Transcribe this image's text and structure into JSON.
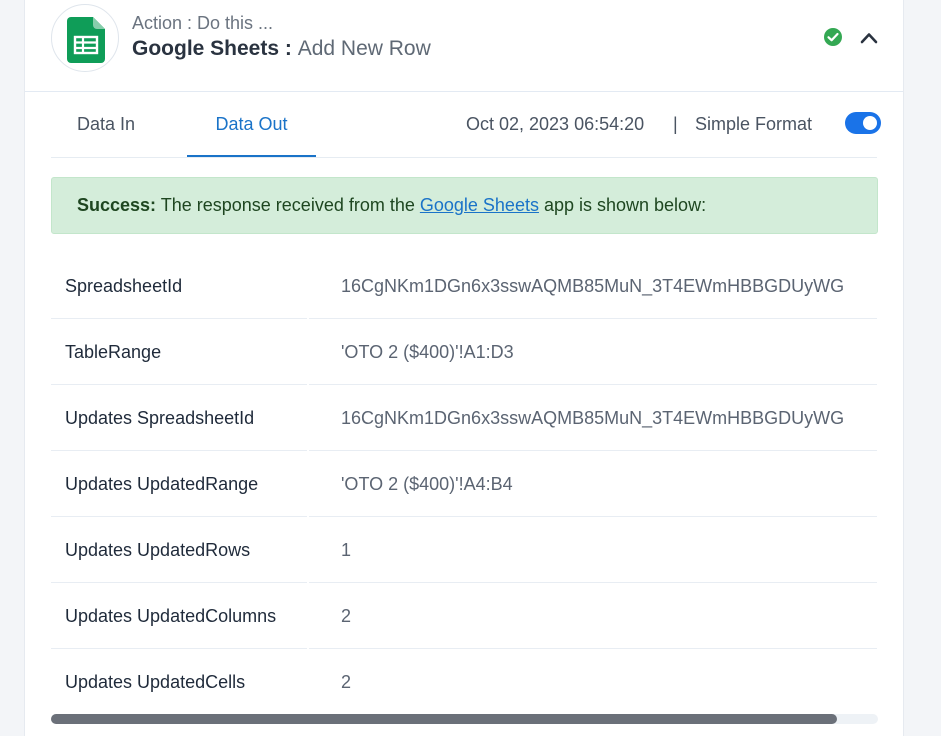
{
  "header": {
    "action_label": "Action : Do this ...",
    "app_name": "Google Sheets :",
    "action_name": "Add New Row",
    "app_icon": "google-sheets-icon",
    "status_icon": "check-circle-icon",
    "collapse_icon": "chevron-up-icon"
  },
  "tabs": [
    {
      "label": "Data In",
      "active": false
    },
    {
      "label": "Data Out",
      "active": true
    }
  ],
  "meta": {
    "timestamp": "Oct 02, 2023 06:54:20",
    "separator": "|",
    "simple_format_label": "Simple Format",
    "simple_format_on": true
  },
  "alert": {
    "prefix": "Success:",
    "text_before": " The response received from the ",
    "link": "Google Sheets",
    "text_after": " app is shown below:"
  },
  "rows": [
    {
      "key": "SpreadsheetId",
      "value": "16CgNKm1DGn6x3sswAQMB85MuN_3T4EWmHBBGDUyWG"
    },
    {
      "key": "TableRange",
      "value": "'OTO 2 ($400)'!A1:D3"
    },
    {
      "key": "Updates SpreadsheetId",
      "value": "16CgNKm1DGn6x3sswAQMB85MuN_3T4EWmHBBGDUyWG"
    },
    {
      "key": "Updates UpdatedRange",
      "value": "'OTO 2 ($400)'!A4:B4"
    },
    {
      "key": "Updates UpdatedRows",
      "value": "1"
    },
    {
      "key": "Updates UpdatedColumns",
      "value": "2"
    },
    {
      "key": "Updates UpdatedCells",
      "value": "2"
    }
  ],
  "scroll": {
    "horizontal_position_fraction": 0.95
  },
  "colors": {
    "accent": "#1a73c8",
    "success_bg": "#d4edda",
    "success_icon": "#34a853",
    "sheets_green": "#0f9d58"
  }
}
